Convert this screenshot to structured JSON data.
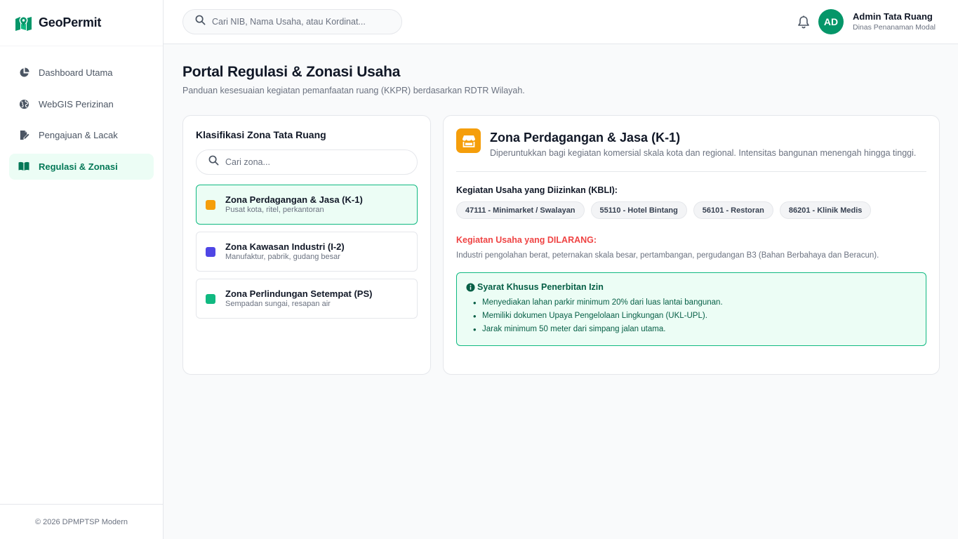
{
  "brand": {
    "name": "GeoPermit",
    "icon": "map-pin-logo-icon",
    "color": "#059669"
  },
  "sidebar": {
    "items": [
      {
        "label": "Dashboard Utama",
        "icon": "pie-chart-icon",
        "active": false
      },
      {
        "label": "WebGIS Perizinan",
        "icon": "globe-icon",
        "active": false
      },
      {
        "label": "Pengajuan & Lacak",
        "icon": "file-signature-icon",
        "active": false
      },
      {
        "label": "Regulasi & Zonasi",
        "icon": "book-open-icon",
        "active": true
      }
    ],
    "footer": "© 2026 DPMPTSP Modern"
  },
  "topbar": {
    "search_placeholder": "Cari NIB, Nama Usaha, atau Kordinat...",
    "user": {
      "initials": "AD",
      "name": "Admin Tata Ruang",
      "role": "Dinas Penanaman Modal"
    }
  },
  "page": {
    "title": "Portal Regulasi & Zonasi Usaha",
    "subtitle": "Panduan kesesuaian kegiatan pemanfaatan ruang (KKPR) berdasarkan RDTR Wilayah."
  },
  "zones_panel": {
    "title": "Klasifikasi Zona Tata Ruang",
    "search_placeholder": "Cari zona...",
    "zones": [
      {
        "name": "Zona Perdagangan & Jasa (K-1)",
        "desc": "Pusat kota, ritel, perkantoran",
        "color": "#f59e0b",
        "selected": true
      },
      {
        "name": "Zona Kawasan Industri (I-2)",
        "desc": "Manufaktur, pabrik, gudang besar",
        "color": "#4f46e5",
        "selected": false
      },
      {
        "name": "Zona Perlindungan Setempat (PS)",
        "desc": "Sempadan sungai, resapan air",
        "color": "#10b981",
        "selected": false
      }
    ]
  },
  "detail": {
    "title": "Zona Perdagangan & Jasa (K-1)",
    "desc": "Diperuntukkan bagi kegiatan komersial skala kota dan regional. Intensitas bangunan menengah hingga tinggi.",
    "allowed_label": "Kegiatan Usaha yang Diizinkan (KBLI):",
    "allowed": [
      "47111 - Minimarket / Swalayan",
      "55110 - Hotel Bintang",
      "56101 - Restoran",
      "86201 - Klinik Medis"
    ],
    "forbidden_label": "Kegiatan Usaha yang DILARANG:",
    "forbidden_text": "Industri pengolahan berat, peternakan skala besar, pertambangan, pergudangan B3 (Bahan Berbahaya dan Beracun).",
    "requirements_title": "Syarat Khusus Penerbitan Izin",
    "requirements": [
      "Menyediakan lahan parkir minimum 20% dari luas lantai bangunan.",
      "Memiliki dokumen Upaya Pengelolaan Lingkungan (UKL-UPL).",
      "Jarak minimum 50 meter dari simpang jalan utama."
    ]
  }
}
